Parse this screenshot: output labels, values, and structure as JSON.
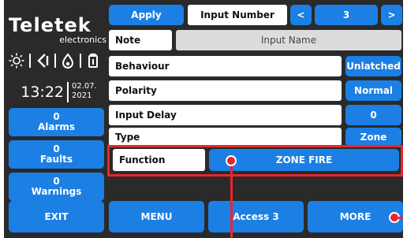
{
  "brand": {
    "name": "Teletek",
    "sub": "electronics"
  },
  "clock": {
    "time": "13:22",
    "date_line1": "02.07.",
    "date_line2": "2021"
  },
  "top": {
    "apply_label": "Apply",
    "input_number_label": "Input Number",
    "prev_symbol": "<",
    "next_symbol": ">",
    "input_number_value": "3"
  },
  "left_buttons": [
    {
      "count": "0",
      "label": "Alarms"
    },
    {
      "count": "0",
      "label": "Faults"
    },
    {
      "count": "0",
      "label": "Warnings"
    }
  ],
  "fields": {
    "note": {
      "label": "Note",
      "value": "Input Name"
    },
    "behaviour": {
      "label": "Behaviour",
      "value": "Unlatched"
    },
    "polarity": {
      "label": "Polarity",
      "value": "Normal"
    },
    "input_delay": {
      "label": "Input Delay",
      "value": "0"
    },
    "type": {
      "label": "Type",
      "value": "Zone"
    },
    "function": {
      "label": "Function",
      "value": "ZONE FIRE"
    }
  },
  "bottom": {
    "exit_label": "EXIT",
    "menu_label": "MENU",
    "access_label": "Access 3",
    "more_label": "MORE"
  },
  "colors": {
    "screen_bg": "#2a2a2a",
    "button_blue": "#1c7fe3",
    "highlight_red": "#e8262b"
  },
  "icons": [
    "sun-icon",
    "speaker-mute-icon",
    "fire-drop-icon",
    "buzzer-icon"
  ]
}
